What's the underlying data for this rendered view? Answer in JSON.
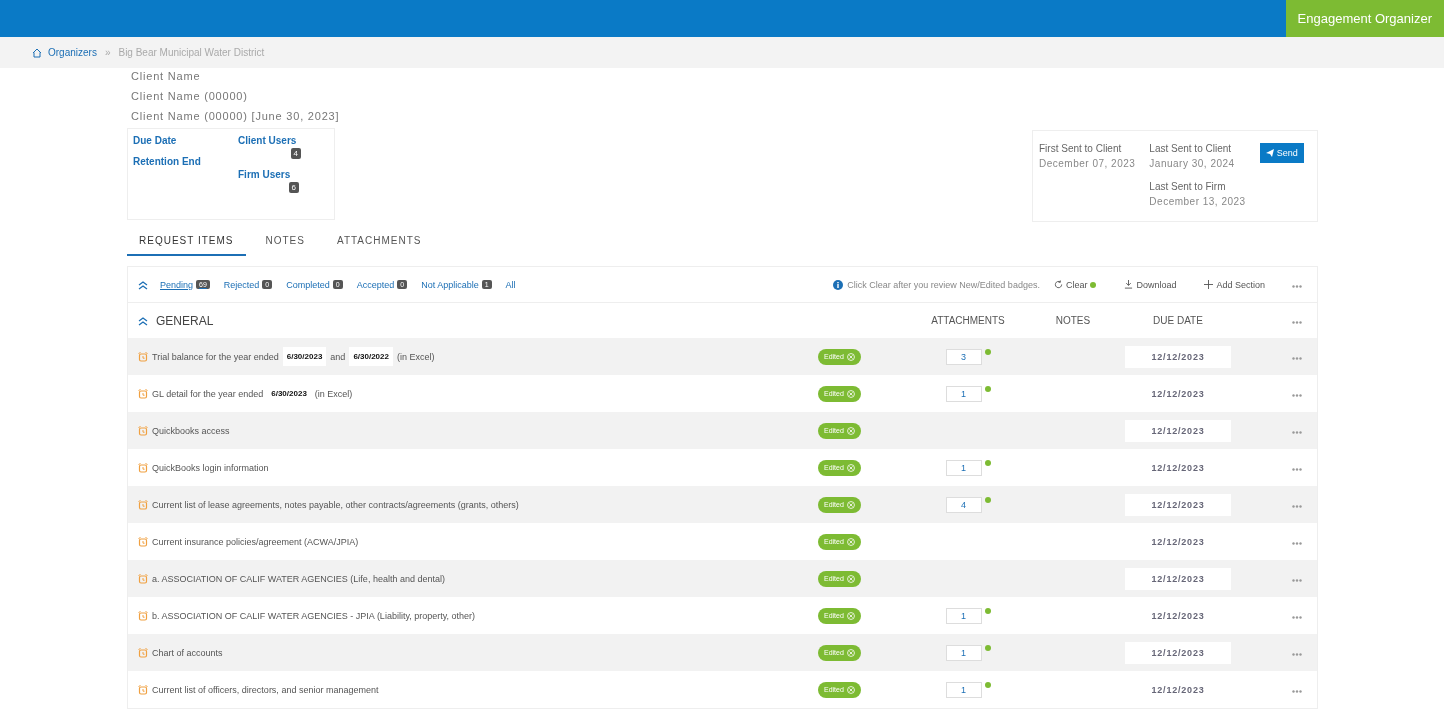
{
  "header": {
    "app_button": "Engagement Organizer"
  },
  "breadcrumb": [
    {
      "label": "Organizers",
      "kind": "link"
    },
    {
      "label": "»",
      "kind": "separator"
    },
    {
      "label": "Big Bear Municipal Water District",
      "kind": "current"
    }
  ],
  "client_names": [
    "Client Name",
    "Client Name (00000)",
    "Client Name (00000) [June 30, 2023]"
  ],
  "info_card": {
    "due_date": "Due Date",
    "retention_end": "Retention End",
    "client_users": "Client Users",
    "client_users_count": "4",
    "firm_users": "Firm Users",
    "firm_users_count": "6"
  },
  "sent_card": {
    "first_sent_label": "First Sent to Client",
    "first_sent": "December 07, 2023",
    "last_sent_client_label": "Last Sent to Client",
    "last_sent_client": "January 30, 2024",
    "last_sent_firm_label": "Last Sent to Firm",
    "last_sent_firm": "December 13, 2023",
    "send_button": "Send"
  },
  "tabs": [
    {
      "label": "REQUEST ITEMS",
      "selected": true
    },
    {
      "label": "NOTES",
      "selected": false
    },
    {
      "label": "ATTACHMENTS",
      "selected": false
    }
  ],
  "filters": [
    {
      "label": "Pending",
      "count": "69",
      "selected": true
    },
    {
      "label": "Rejected",
      "count": "0",
      "selected": false
    },
    {
      "label": "Completed",
      "count": "0",
      "selected": false
    },
    {
      "label": "Accepted",
      "count": "0",
      "selected": false
    },
    {
      "label": "Not Applicable",
      "count": "1",
      "selected": false
    },
    {
      "label": "All",
      "selected": false
    }
  ],
  "toolbar": {
    "hint": "Click Clear after you review New/Edited badges.",
    "clear": "Clear",
    "clear_new": true,
    "download": "Download",
    "add_section": "Add Section"
  },
  "section": {
    "title": "GENERAL",
    "columns": [
      "ATTACHMENTS",
      "NOTES",
      "DUE DATE"
    ]
  },
  "rows": [
    {
      "segments": [
        {
          "kind": "text",
          "text": "Trial balance for the year ended"
        },
        {
          "kind": "date",
          "text": "6/30/2023"
        },
        {
          "kind": "text",
          "text": "and"
        },
        {
          "kind": "date",
          "text": "6/30/2022"
        },
        {
          "kind": "text",
          "text": "(in Excel)"
        }
      ],
      "status": "Edited",
      "attachments": "3",
      "new": true,
      "due": "12/12/2023"
    },
    {
      "segments": [
        {
          "kind": "text",
          "text": "GL detail for the year ended"
        },
        {
          "kind": "date",
          "text": "6/30/2023"
        },
        {
          "kind": "text",
          "text": "(in Excel)"
        }
      ],
      "status": "Edited",
      "attachments": "1",
      "new": true,
      "due": "12/12/2023"
    },
    {
      "segments": [
        {
          "kind": "text",
          "text": "Quickbooks access"
        }
      ],
      "status": "Edited",
      "due": "12/12/2023"
    },
    {
      "segments": [
        {
          "kind": "text",
          "text": "QuickBooks login information"
        }
      ],
      "status": "Edited",
      "attachments": "1",
      "new": true,
      "due": "12/12/2023"
    },
    {
      "segments": [
        {
          "kind": "text",
          "text": "Current list of lease agreements, notes payable, other contracts/agreements (grants, others)"
        }
      ],
      "status": "Edited",
      "attachments": "4",
      "new": true,
      "due": "12/12/2023"
    },
    {
      "segments": [
        {
          "kind": "text",
          "text": "Current insurance policies/agreement (ACWA/JPIA)"
        }
      ],
      "status": "Edited",
      "due": "12/12/2023"
    },
    {
      "segments": [
        {
          "kind": "text",
          "text": "a. ASSOCIATION OF CALIF WATER AGENCIES (Life, health and dental)"
        }
      ],
      "status": "Edited",
      "due": "12/12/2023"
    },
    {
      "segments": [
        {
          "kind": "text",
          "text": "b. ASSOCIATION OF CALIF WATER AGENCIES - JPIA (Liability, property, other)"
        }
      ],
      "status": "Edited",
      "attachments": "1",
      "new": true,
      "due": "12/12/2023"
    },
    {
      "segments": [
        {
          "kind": "text",
          "text": "Chart of accounts"
        }
      ],
      "status": "Edited",
      "attachments": "1",
      "new": true,
      "due": "12/12/2023"
    },
    {
      "segments": [
        {
          "kind": "text",
          "text": "Current list of officers, directors, and senior management"
        }
      ],
      "status": "Edited",
      "attachments": "1",
      "new": true,
      "due": "12/12/2023"
    }
  ]
}
